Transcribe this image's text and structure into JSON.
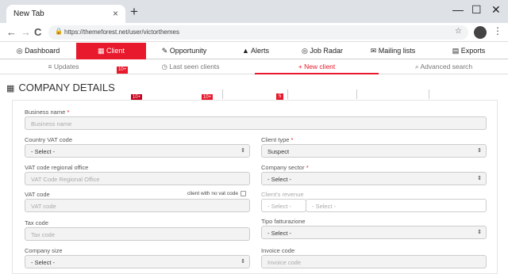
{
  "browser": {
    "tab_title": "New Tab",
    "tab_close": "×",
    "new_tab": "+",
    "url": "https://themeforest.net/user/victorthemes",
    "win_min": "—",
    "win_max": "☐",
    "win_close": "✕",
    "back": "←",
    "forward": "→",
    "reload": "C",
    "lock": "🔒",
    "star": "☆",
    "menu": "⋮"
  },
  "nav": [
    {
      "icon": "◎",
      "label": "Dashboard",
      "icon_name": "dashboard-icon"
    },
    {
      "icon": "▦",
      "label": "Client",
      "icon_name": "building-icon",
      "active": true,
      "badge": "10+"
    },
    {
      "icon": "✎",
      "label": "Opportunity",
      "icon_name": "pencil-icon",
      "badge": "10+"
    },
    {
      "icon": "▲",
      "label": "Alerts",
      "icon_name": "bell-icon",
      "badge": "5"
    },
    {
      "icon": "◎",
      "label": "Job Radar",
      "icon_name": "radar-icon"
    },
    {
      "icon": "✉",
      "label": "Mailing lists",
      "icon_name": "mail-icon"
    },
    {
      "icon": "▤",
      "label": "Exports",
      "icon_name": "export-icon"
    }
  ],
  "subnav": [
    {
      "icon": "≡",
      "label": "Updates",
      "badge": "10+"
    },
    {
      "icon": "◷",
      "label": "Last seen clients"
    },
    {
      "icon": "+",
      "label": "New client",
      "active": true
    },
    {
      "icon": "⌕",
      "label": "Advanced search"
    }
  ],
  "section": {
    "title": "COMPANY DETAILS",
    "icon": "▦"
  },
  "form": {
    "business_name": {
      "label": "Business name",
      "req": "*",
      "placeholder": "Business name"
    },
    "country_vat": {
      "label": "Country VAT code",
      "value": "- Select -"
    },
    "client_type": {
      "label": "Client type",
      "req": "*",
      "value": "Suspect"
    },
    "vat_regional": {
      "label": "VAT code regional office",
      "placeholder": "VAT Code Regional Office"
    },
    "company_sector": {
      "label": "Company sector",
      "req": "*",
      "value": "- Select -"
    },
    "vat_code": {
      "label": "VAT code",
      "placeholder": "VAT code",
      "checkbox_label": "client with no vat code"
    },
    "revenue": {
      "label": "Client's revenue",
      "value1": "- Select -",
      "value2": "- Select -"
    },
    "tax_code": {
      "label": "Tax code",
      "placeholder": "Tax code"
    },
    "billing": {
      "label": "Tipo fatturazione",
      "value": "- Select -"
    },
    "company_size": {
      "label": "Company size",
      "value": "- Select -"
    },
    "invoice_code": {
      "label": "Invoice code",
      "placeholder": "Invoice code"
    },
    "arrow": "⇕"
  }
}
